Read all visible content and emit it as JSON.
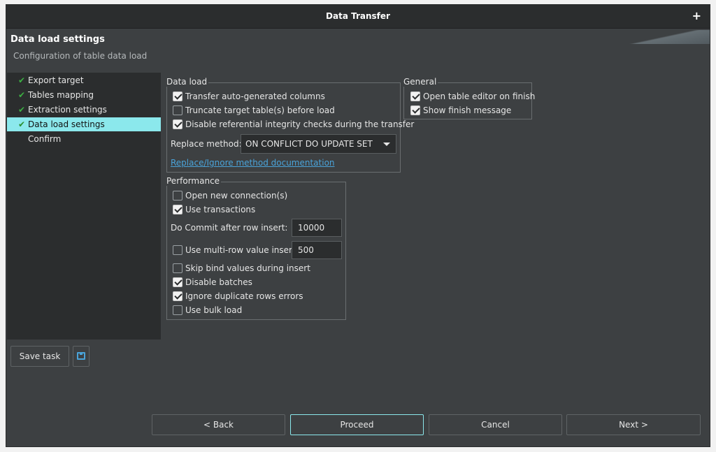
{
  "window": {
    "title": "Data Transfer"
  },
  "header": {
    "title": "Data load settings",
    "subtitle": "Configuration of table data load"
  },
  "nav": {
    "items": [
      {
        "label": "Export target",
        "done": true
      },
      {
        "label": "Tables mapping",
        "done": true
      },
      {
        "label": "Extraction settings",
        "done": true
      },
      {
        "label": "Data load settings",
        "done": true,
        "selected": true
      },
      {
        "label": "Confirm",
        "done": false
      }
    ]
  },
  "data_load": {
    "group_label": "Data load",
    "transfer_auto_generated": {
      "label": "Transfer auto-generated columns",
      "checked": true
    },
    "truncate_target": {
      "label": "Truncate target table(s) before load",
      "checked": false
    },
    "disable_ref_integrity": {
      "label": "Disable referential integrity checks during the transfer",
      "checked": true
    },
    "replace_method_label": "Replace method:",
    "replace_method_value": "ON CONFLICT DO UPDATE SET",
    "doc_link": "Replace/Ignore method documentation"
  },
  "general": {
    "group_label": "General",
    "open_table_editor": {
      "label": "Open table editor on finish",
      "checked": true
    },
    "show_finish_message": {
      "label": "Show finish message",
      "checked": true
    }
  },
  "performance": {
    "group_label": "Performance",
    "open_new_connections": {
      "label": "Open new connection(s)",
      "checked": false
    },
    "use_transactions": {
      "label": "Use transactions",
      "checked": true
    },
    "commit_label": "Do Commit after row insert:",
    "commit_value": "10000",
    "multi_row": {
      "label": "Use multi-row value insert",
      "checked": false
    },
    "multi_row_value": "500",
    "skip_bind": {
      "label": "Skip bind values during insert",
      "checked": false
    },
    "disable_batches": {
      "label": "Disable batches",
      "checked": true
    },
    "ignore_duplicates": {
      "label": "Ignore duplicate rows errors",
      "checked": true
    },
    "use_bulk_load": {
      "label": "Use bulk load",
      "checked": false
    }
  },
  "toolbar": {
    "save_task": "Save task",
    "save_icon": "save-icon"
  },
  "footer": {
    "back": "< Back",
    "proceed": "Proceed",
    "cancel": "Cancel",
    "next": "Next >"
  }
}
